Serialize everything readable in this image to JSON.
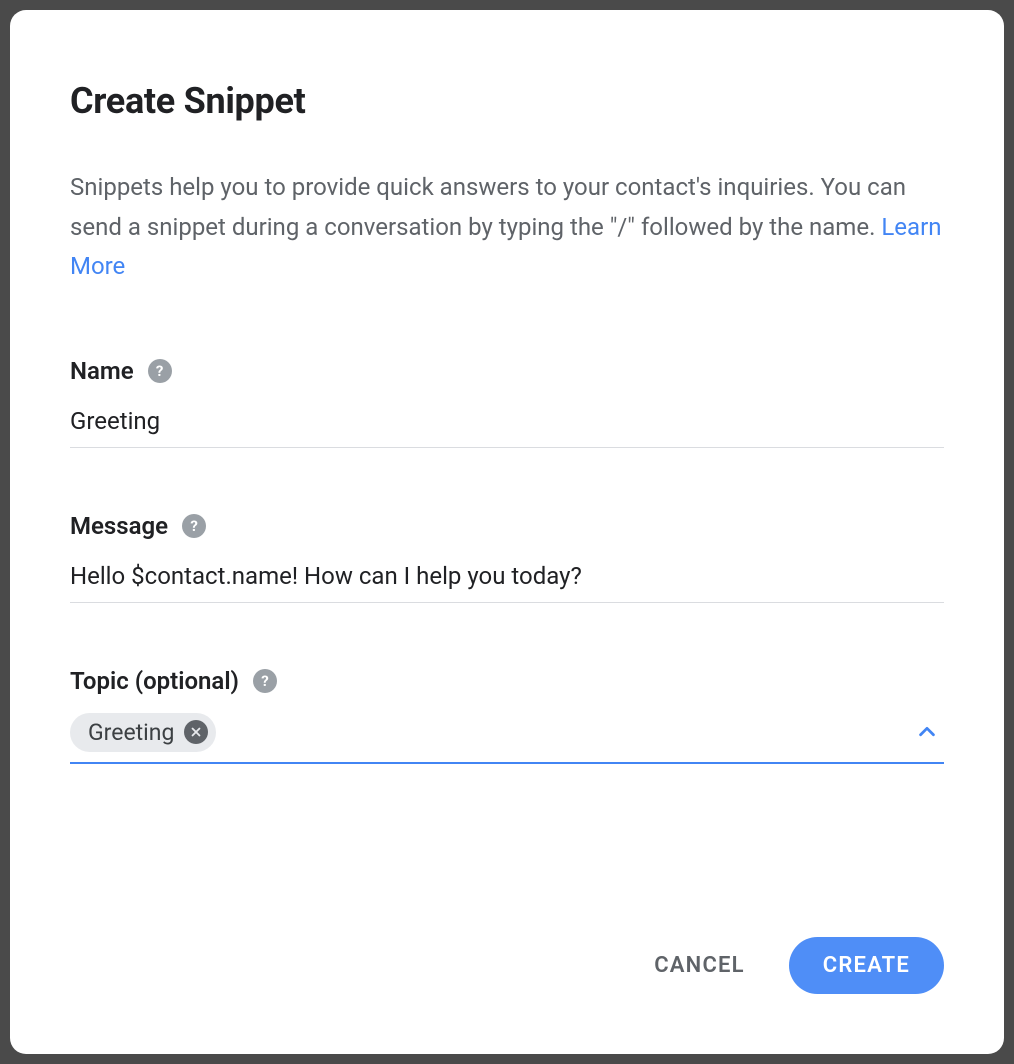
{
  "dialog": {
    "title": "Create Snippet",
    "description_pre": "Snippets help you to provide quick answers to your contact's inquiries. You can send a snippet during a conversation by typing the \"/\" followed by the name. ",
    "learn_more_label": "Learn More"
  },
  "fields": {
    "name": {
      "label": "Name",
      "value": "Greeting"
    },
    "message": {
      "label": "Message",
      "value": "Hello $contact.name! How can I help you today?"
    },
    "topic": {
      "label": "Topic (optional)",
      "chips": [
        {
          "label": "Greeting"
        }
      ]
    }
  },
  "actions": {
    "cancel_label": "CANCEL",
    "create_label": "CREATE"
  },
  "icons": {
    "help": "?",
    "chip_close": "x",
    "chevron": "chevron-up"
  },
  "colors": {
    "accent": "#4285f4",
    "primary_button": "#4f8ef7",
    "text_primary": "#202124",
    "text_secondary": "#5f6368",
    "chip_bg": "#e8eaed"
  }
}
